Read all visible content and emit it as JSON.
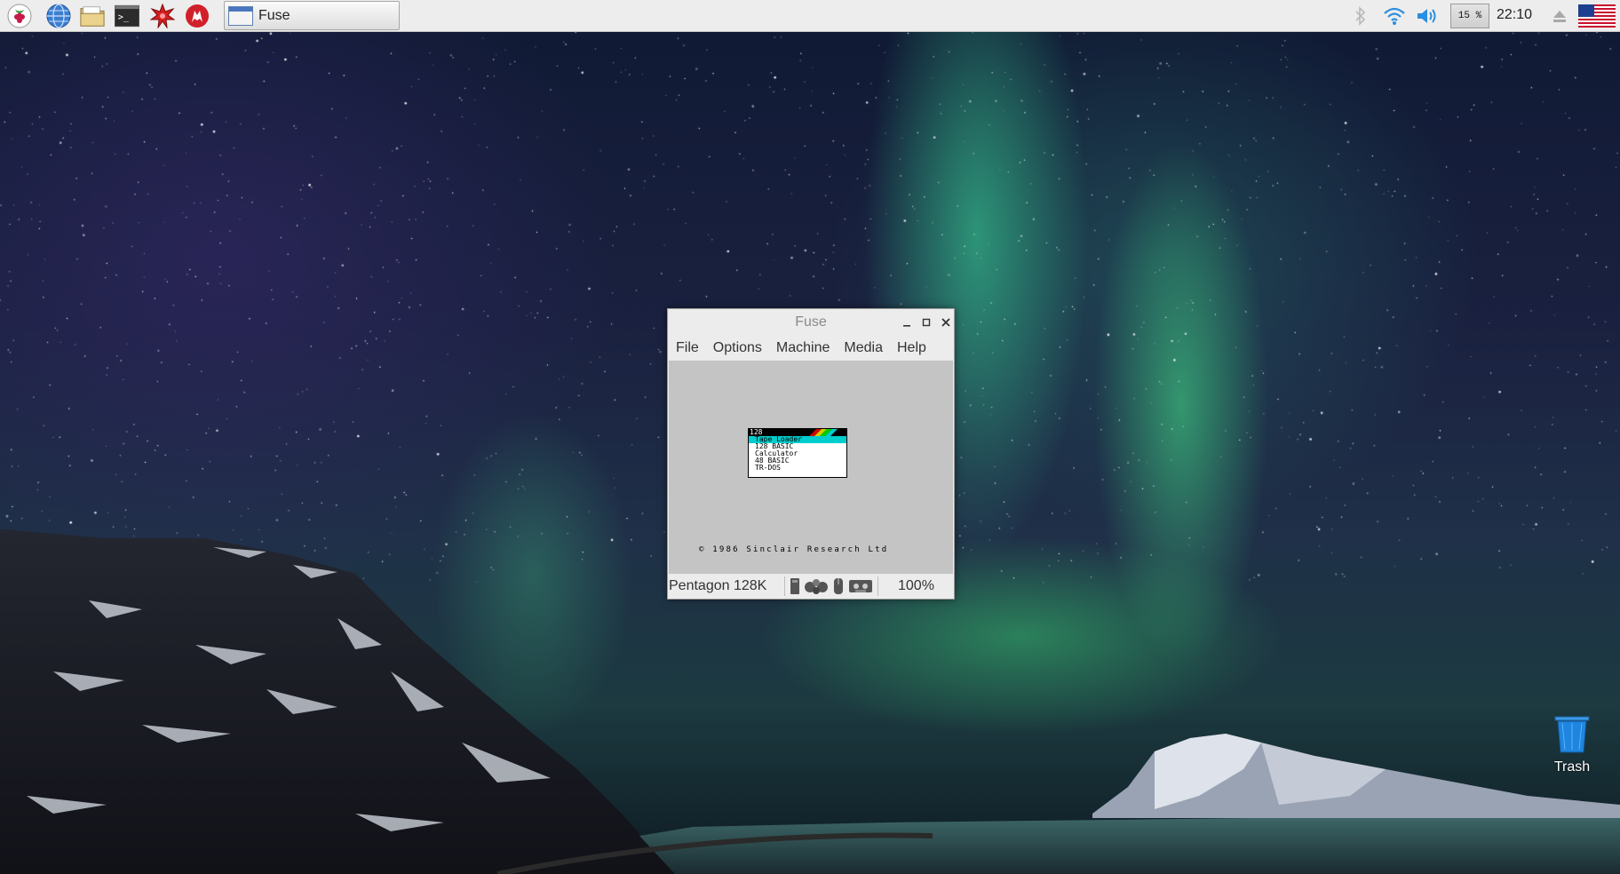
{
  "taskbar": {
    "launchers": [
      {
        "name": "raspberry-menu-icon"
      },
      {
        "name": "web-browser-icon"
      },
      {
        "name": "file-manager-icon"
      },
      {
        "name": "terminal-icon"
      },
      {
        "name": "mathematica-icon"
      },
      {
        "name": "wolfram-icon"
      }
    ],
    "task_button": {
      "label": "Fuse"
    },
    "tray": {
      "bluetooth": "bluetooth-icon",
      "wifi": "wifi-icon",
      "volume": "volume-icon",
      "cpu_usage": "15 %",
      "clock": "22:10",
      "eject": "eject-icon",
      "keyboard_layout": "us-flag-icon"
    }
  },
  "desktop": {
    "trash_label": "Trash"
  },
  "fuse_window": {
    "title": "Fuse",
    "menu": [
      "File",
      "Options",
      "Machine",
      "Media",
      "Help"
    ],
    "spectrum_screen": {
      "menu_header": "128",
      "menu_items": [
        "Tape Loader",
        "128 BASIC",
        "Calculator",
        "48 BASIC",
        "TR-DOS"
      ],
      "selected_index": 0,
      "copyright": "© 1986 Sinclair Research Ltd",
      "stripe_colors": [
        "#cd0000",
        "#cdcd00",
        "#00cd00",
        "#00cdcd"
      ]
    },
    "status": {
      "machine": "Pentagon 128K",
      "speed": "100%",
      "icons": [
        "microdrive-icon",
        "disk-drive-icon",
        "mouse-icon",
        "tape-icon"
      ]
    }
  }
}
